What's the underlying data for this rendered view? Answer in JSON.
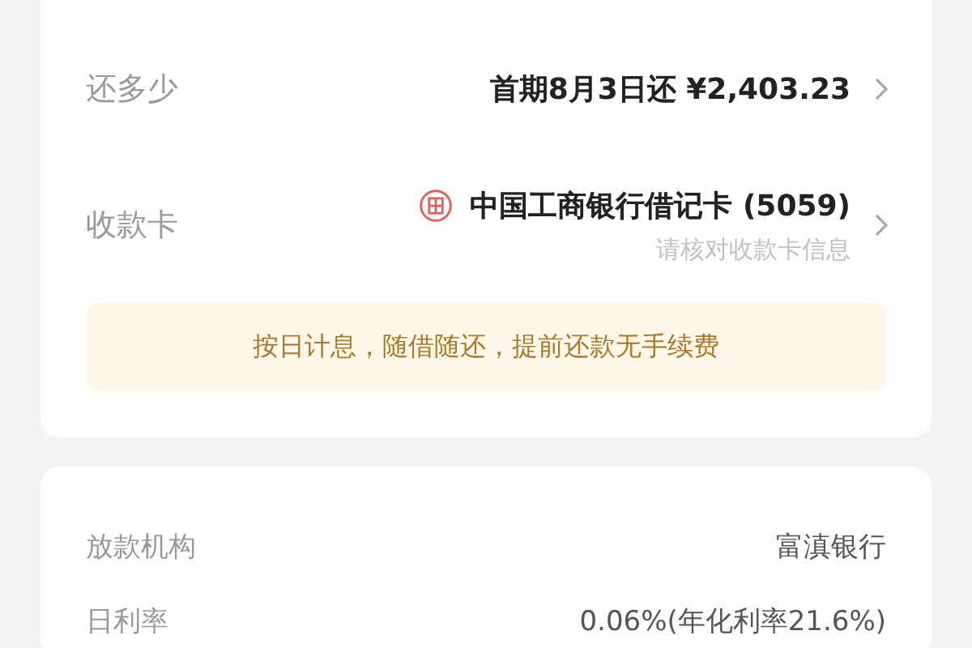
{
  "repay_card": {
    "rows": [
      {
        "kind": "amount",
        "label": "还多少",
        "value": "首期8月3日还 ¥2,403.23"
      },
      {
        "kind": "bank",
        "label": "收款卡",
        "value": "中国工商银行借记卡 (5059)",
        "hint": "请核对收款卡信息"
      }
    ],
    "notice": "按日计息，随借随还，提前还款无手续费"
  },
  "loan_info": {
    "rows": [
      {
        "label": "放款机构",
        "value": "富滇银行"
      },
      {
        "label": "日利率",
        "value": "0.06%(年化利率21.6%)"
      }
    ]
  }
}
